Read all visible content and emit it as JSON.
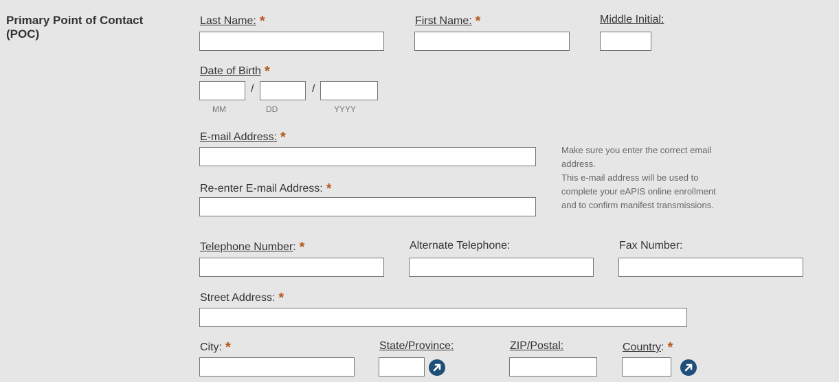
{
  "section": {
    "title": "Primary Point of Contact (POC)"
  },
  "fields": {
    "last_name": {
      "label": "Last Name:",
      "required": "*",
      "value": ""
    },
    "first_name": {
      "label": "First Name:",
      "required": "*",
      "value": ""
    },
    "middle_initial": {
      "label": "Middle Initial:",
      "value": ""
    },
    "dob": {
      "label": "Date of Birth",
      "required": "*",
      "separator": "/",
      "mm_hint": "MM",
      "dd_hint": "DD",
      "yyyy_hint": "YYYY"
    },
    "email": {
      "label": "E-mail Address:",
      "required": "*",
      "value": ""
    },
    "email_confirm": {
      "label": "Re-enter E-mail Address:",
      "required": "*",
      "value": ""
    },
    "telephone": {
      "label": "Telephone Number",
      "suffix": ":",
      "required": "*",
      "value": ""
    },
    "alt_telephone": {
      "label": "Alternate Telephone:",
      "value": ""
    },
    "fax": {
      "label": "Fax Number:",
      "value": ""
    },
    "street": {
      "label": "Street Address:",
      "required": "*",
      "value": ""
    },
    "city": {
      "label": "City:",
      "required": "*",
      "value": ""
    },
    "state": {
      "label": "State/Province:",
      "value": "",
      "lookup_icon": "arrow-lookup-icon"
    },
    "zip": {
      "label": "ZIP/Postal:",
      "value": ""
    },
    "country": {
      "label": "Country",
      "suffix": ":",
      "required": "*",
      "value": "",
      "lookup_icon": "arrow-lookup-icon"
    }
  },
  "email_note": {
    "line1": "Make sure you enter the correct email",
    "line2": "address.",
    "line3": "This e-mail address will be used to",
    "line4": "complete your eAPIS online enrollment",
    "line5": "and to confirm manifest transmissions."
  },
  "colors": {
    "background": "#e6e6e6",
    "required": "#b8581e",
    "lookup_icon": "#1f4e79"
  }
}
